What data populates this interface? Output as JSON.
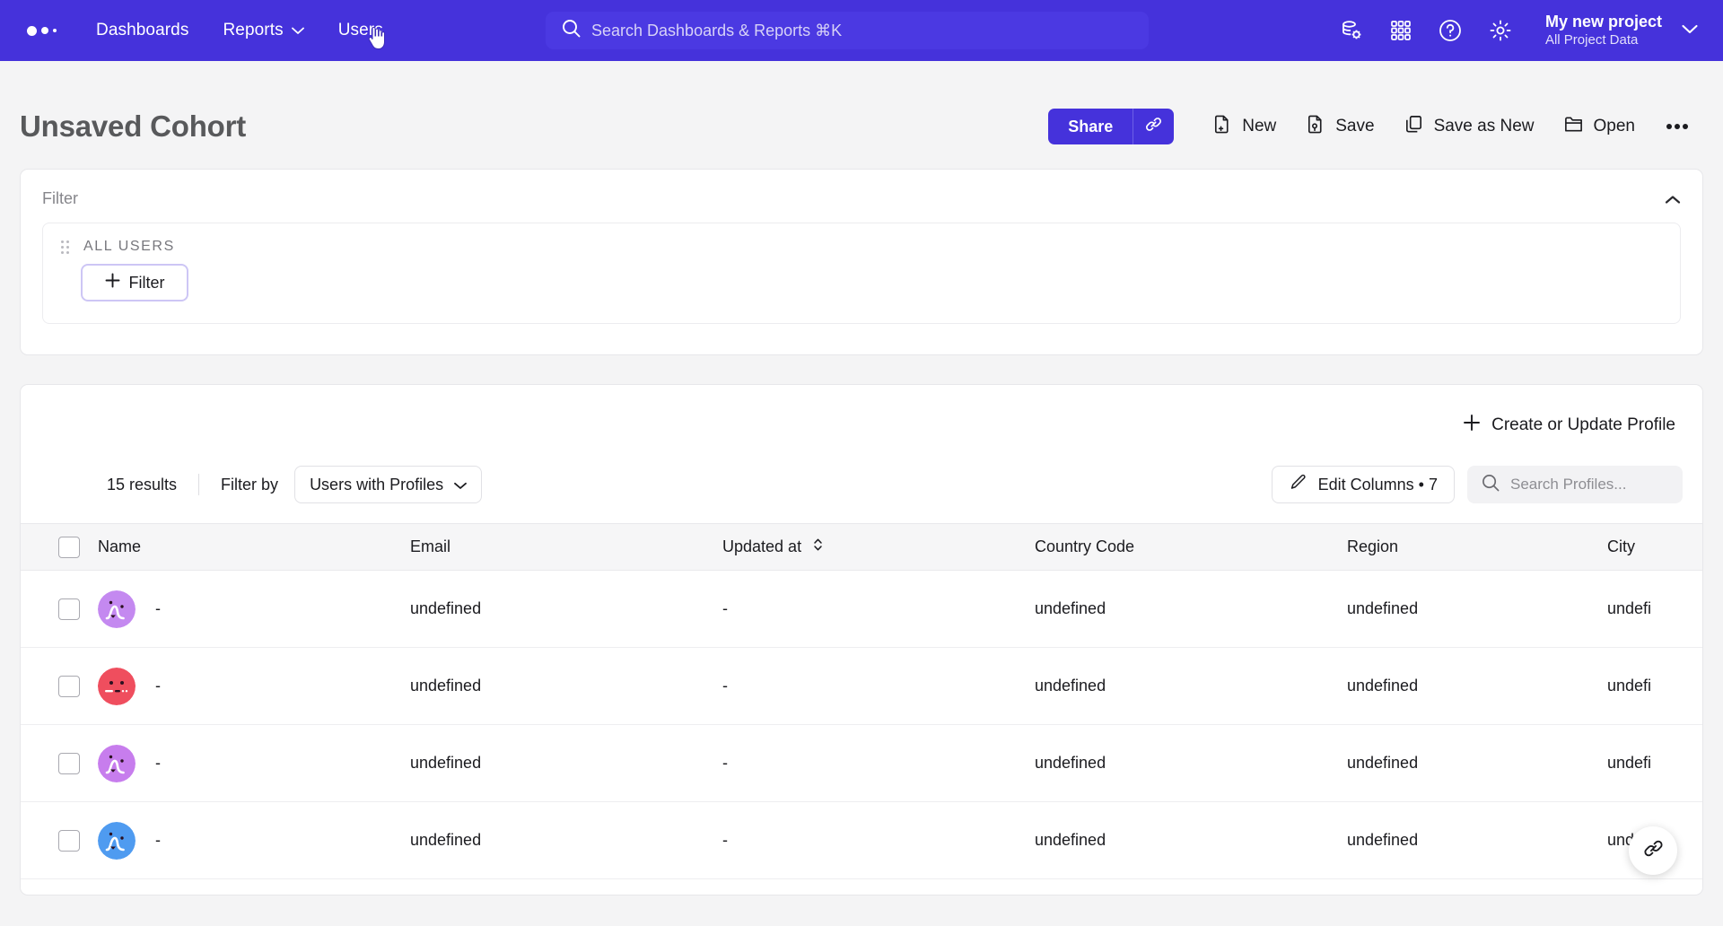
{
  "navbar": {
    "logo_name": "logo-dots",
    "links": [
      {
        "label": "Dashboards",
        "has_chevron": false
      },
      {
        "label": "Reports",
        "has_chevron": true
      },
      {
        "label": "Users",
        "has_chevron": false
      }
    ],
    "search": {
      "placeholder": "Search Dashboards & Reports ⌘K",
      "icon": "search-icon"
    },
    "icons": [
      "database-settings-icon",
      "apps-grid-icon",
      "help-circle-icon",
      "gear-icon"
    ],
    "project": {
      "name": "My new project",
      "subtitle": "All Project Data"
    },
    "accent": "#4532db"
  },
  "page": {
    "title": "Unsaved Cohort",
    "toolbar": {
      "share_label": "Share",
      "share_link_icon": "link-icon",
      "buttons": [
        {
          "label": "New",
          "icon": "file-plus-icon"
        },
        {
          "label": "Save",
          "icon": "file-save-icon"
        },
        {
          "label": "Save as New",
          "icon": "copy-icon"
        },
        {
          "label": "Open",
          "icon": "folder-open-icon"
        }
      ],
      "more_label": "•••"
    }
  },
  "filter_panel": {
    "label": "Filter",
    "collapse_icon": "chevron-up-icon",
    "group_label": "ALL USERS",
    "add_filter_label": "Filter",
    "add_filter_icon": "plus-icon"
  },
  "results": {
    "create_profile_label": "Create or Update Profile",
    "count_label": "15 results",
    "filter_by_label": "Filter by",
    "filter_by_value": "Users with Profiles",
    "edit_columns_label": "Edit Columns • 7",
    "search_placeholder": "Search Profiles...",
    "columns": [
      {
        "label": "Name",
        "sortable": false
      },
      {
        "label": "Email",
        "sortable": false
      },
      {
        "label": "Updated at",
        "sortable": true
      },
      {
        "label": "Country Code",
        "sortable": false
      },
      {
        "label": "Region",
        "sortable": false
      },
      {
        "label": "City",
        "sortable": false
      }
    ],
    "rows": [
      {
        "name": "-",
        "email": "undefined",
        "updated_at": "-",
        "country_code": "undefined",
        "region": "undefined",
        "city": "undefi",
        "avatar_color": "#c489f0",
        "avatar_style": "squiggle"
      },
      {
        "name": "-",
        "email": "undefined",
        "updated_at": "-",
        "country_code": "undefined",
        "region": "undefined",
        "city": "undefi",
        "avatar_color": "#ef4e5e",
        "avatar_style": "flat"
      },
      {
        "name": "-",
        "email": "undefined",
        "updated_at": "-",
        "country_code": "undefined",
        "region": "undefined",
        "city": "undefi",
        "avatar_color": "#c77ded",
        "avatar_style": "squiggle"
      },
      {
        "name": "-",
        "email": "undefined",
        "updated_at": "-",
        "country_code": "undefined",
        "region": "undefined",
        "city": "undefi",
        "avatar_color": "#4f9bf0",
        "avatar_style": "squiggle"
      }
    ]
  },
  "fab": {
    "icon": "link-icon"
  }
}
